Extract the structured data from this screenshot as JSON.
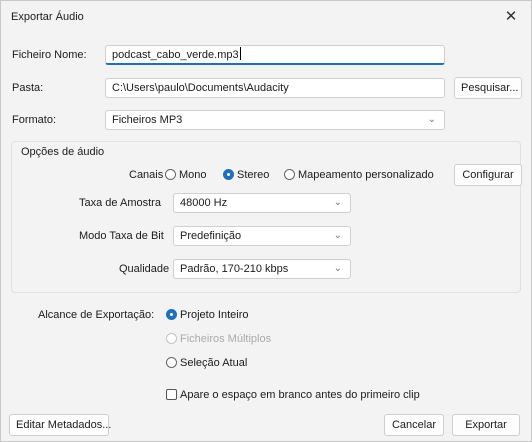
{
  "window": {
    "title": "Exportar Áudio",
    "close_glyph": "✕"
  },
  "file_name": {
    "label": "Ficheiro Nome:",
    "value": "podcast_cabo_verde.mp3"
  },
  "folder": {
    "label": "Pasta:",
    "value": "C:\\Users\\paulo\\Documents\\Audacity",
    "browse_label": "Pesquisar..."
  },
  "format": {
    "label": "Formato:",
    "selected": "Ficheiros MP3"
  },
  "audio_options": {
    "heading": "Opções de áudio",
    "channels": {
      "label": "Canais",
      "options": [
        {
          "label": "Mono",
          "selected": false
        },
        {
          "label": "Stereo",
          "selected": true
        },
        {
          "label": "Mapeamento personalizado",
          "selected": false
        }
      ],
      "configure_label": "Configurar"
    },
    "sample_rate": {
      "label": "Taxa de Amostra",
      "selected": "48000 Hz"
    },
    "bit_rate_mode": {
      "label": "Modo Taxa de Bit",
      "selected": "Predefinição"
    },
    "quality": {
      "label": "Qualidade",
      "selected": "Padrão, 170-210 kbps"
    }
  },
  "export_range": {
    "label": "Alcance de Exportação:",
    "options": [
      {
        "label": "Projeto Inteiro",
        "selected": true,
        "enabled": true
      },
      {
        "label": "Ficheiros Múltiplos",
        "selected": false,
        "enabled": false
      },
      {
        "label": "Seleção Atual",
        "selected": false,
        "enabled": true
      }
    ],
    "trim_label": "Apare o espaço em branco antes do primeiro clip",
    "trim_checked": false
  },
  "footer": {
    "edit_metadata_label": "Editar Metadados...",
    "cancel_label": "Cancelar",
    "export_label": "Exportar"
  },
  "colors": {
    "accent": "#1f6fb9",
    "background": "#f3f3f3"
  }
}
